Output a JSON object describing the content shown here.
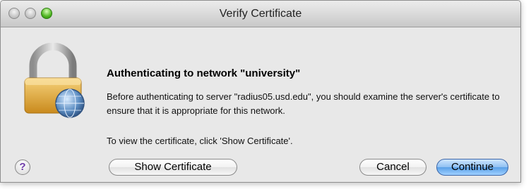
{
  "window": {
    "title": "Verify Certificate"
  },
  "dialog": {
    "icon": "lock-with-globe-icon",
    "heading": "Authenticating to network \"university\"",
    "message": "Before authenticating to server \"radius05.usd.edu\", you should examine the server's certificate to ensure that it is appropriate for this network.",
    "hint": "To view the certificate, click 'Show Certificate'."
  },
  "buttons": {
    "help_label": "?",
    "show_certificate": "Show Certificate",
    "cancel": "Cancel",
    "continue": "Continue"
  },
  "colors": {
    "default_button": "#5aa0e8",
    "help_glyph": "#6d3aa8",
    "lock_body": "#e0a83a"
  }
}
